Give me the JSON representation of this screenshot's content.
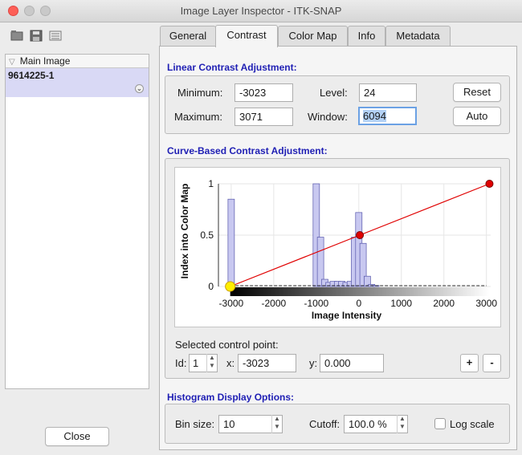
{
  "window": {
    "title": "Image Layer Inspector - ITK-SNAP"
  },
  "layers": {
    "header": "Main Image",
    "items": [
      {
        "name": "9614225-1"
      }
    ]
  },
  "close_label": "Close",
  "tabs": [
    {
      "label": "General",
      "active": false
    },
    {
      "label": "Contrast",
      "active": true
    },
    {
      "label": "Color Map",
      "active": false
    },
    {
      "label": "Info",
      "active": false
    },
    {
      "label": "Metadata",
      "active": false
    }
  ],
  "linear": {
    "title": "Linear Contrast Adjustment:",
    "minimum_label": "Minimum:",
    "minimum": "-3023",
    "maximum_label": "Maximum:",
    "maximum": "3071",
    "level_label": "Level:",
    "level": "24",
    "window_label": "Window:",
    "window": "6094",
    "reset_label": "Reset",
    "auto_label": "Auto"
  },
  "curve": {
    "title": "Curve-Based Contrast Adjustment:",
    "selected_label": "Selected control point:",
    "id_label": "Id:",
    "id": "1",
    "x_label": "x:",
    "x": "-3023",
    "y_label": "y:",
    "y": "0.000",
    "add_label": "+",
    "remove_label": "-"
  },
  "histogram_opts": {
    "title": "Histogram Display Options:",
    "bin_label": "Bin size:",
    "bin": "10",
    "cutoff_label": "Cutoff:",
    "cutoff": "100.0 %",
    "log_label": "Log scale",
    "log_checked": false
  },
  "chart_data": {
    "type": "line",
    "xlabel": "Image Intensity",
    "ylabel": "Index into Color Map",
    "xlim": [
      -3300,
      3100
    ],
    "ylim": [
      0,
      1
    ],
    "x_ticks": [
      -3000,
      -2000,
      -1000,
      0,
      1000,
      2000,
      3000
    ],
    "y_ticks": [
      0,
      0.5,
      1
    ],
    "grid": true,
    "curve": {
      "color": "#e00000",
      "points": [
        {
          "x": -3023,
          "y": 0
        },
        {
          "x": 24,
          "y": 0.5
        },
        {
          "x": 3071,
          "y": 1
        }
      ],
      "selected_color": "#ffee00"
    },
    "histogram": {
      "color": "#c8c8f0",
      "bars": [
        {
          "x": -3000,
          "y": 0.85
        },
        {
          "x": -1000,
          "y": 1.0
        },
        {
          "x": -900,
          "y": 0.48
        },
        {
          "x": -800,
          "y": 0.07
        },
        {
          "x": -700,
          "y": 0.04
        },
        {
          "x": -600,
          "y": 0.05
        },
        {
          "x": -500,
          "y": 0.05
        },
        {
          "x": -400,
          "y": 0.05
        },
        {
          "x": -300,
          "y": 0.04
        },
        {
          "x": -200,
          "y": 0.05
        },
        {
          "x": -100,
          "y": 0.48
        },
        {
          "x": 0,
          "y": 0.72
        },
        {
          "x": 100,
          "y": 0.42
        },
        {
          "x": 200,
          "y": 0.1
        },
        {
          "x": 300,
          "y": 0.02
        },
        {
          "x": 400,
          "y": 0.01
        }
      ]
    }
  }
}
